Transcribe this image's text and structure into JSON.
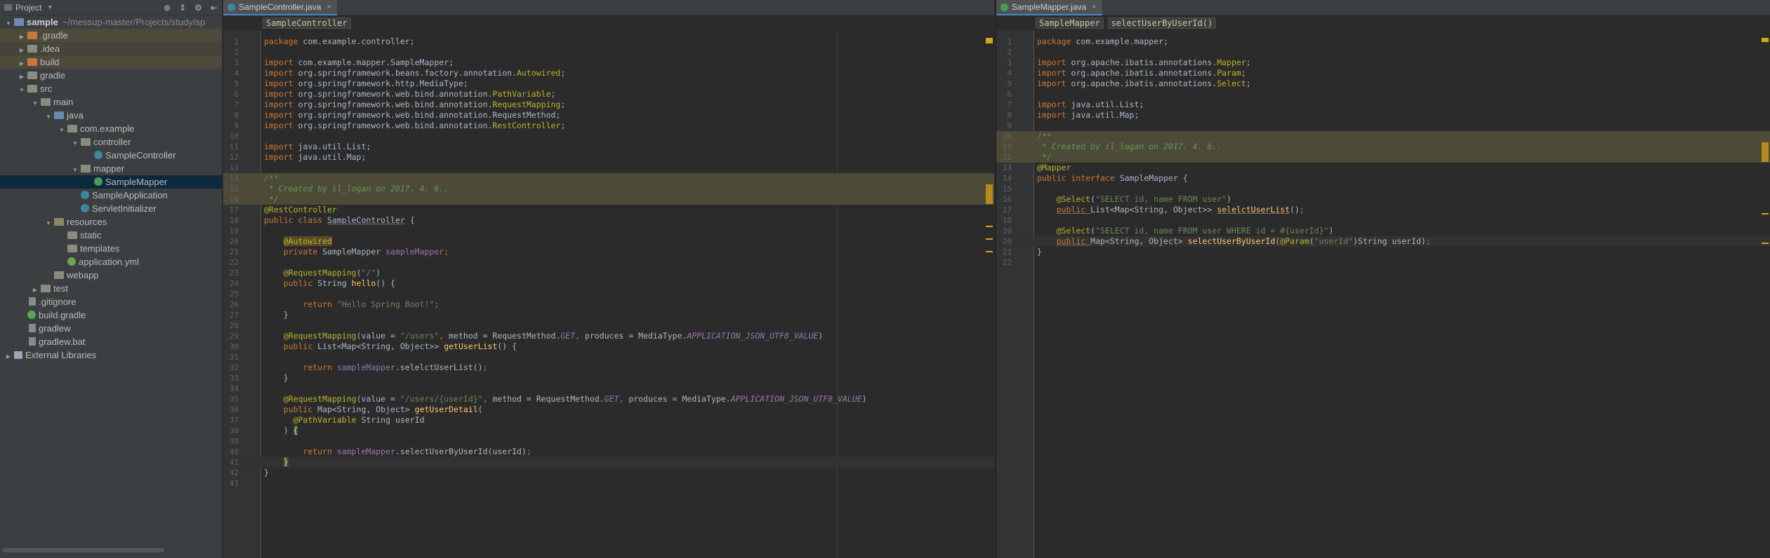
{
  "sidebar": {
    "title": "Project",
    "tree": [
      {
        "label": "sample",
        "suffix": "~/messup-master/Projects/study/sp",
        "depth": 0,
        "arrow": "open",
        "icon": "folder-blue",
        "bold": true
      },
      {
        "label": ".gradle",
        "depth": 1,
        "arrow": "closed",
        "icon": "folder-orange",
        "bg": "hl"
      },
      {
        "label": ".idea",
        "depth": 1,
        "arrow": "closed",
        "icon": "folder",
        "bg": "bg-ex"
      },
      {
        "label": "build",
        "depth": 1,
        "arrow": "closed",
        "icon": "folder-orange",
        "bg": "hl"
      },
      {
        "label": "gradle",
        "depth": 1,
        "arrow": "closed",
        "icon": "folder"
      },
      {
        "label": "src",
        "depth": 1,
        "arrow": "open",
        "icon": "folder"
      },
      {
        "label": "main",
        "depth": 2,
        "arrow": "open",
        "icon": "folder"
      },
      {
        "label": "java",
        "depth": 3,
        "arrow": "open",
        "icon": "folder-src"
      },
      {
        "label": "com.example",
        "depth": 4,
        "arrow": "open",
        "icon": "folder"
      },
      {
        "label": "controller",
        "depth": 5,
        "arrow": "open",
        "icon": "folder"
      },
      {
        "label": "SampleController",
        "depth": 6,
        "arrow": "none",
        "icon": "cls"
      },
      {
        "label": "mapper",
        "depth": 5,
        "arrow": "open",
        "icon": "folder"
      },
      {
        "label": "SampleMapper",
        "depth": 6,
        "arrow": "none",
        "icon": "iface",
        "bg": "sel"
      },
      {
        "label": "SampleApplication",
        "depth": 5,
        "arrow": "none",
        "icon": "cls"
      },
      {
        "label": "ServletInitializer",
        "depth": 5,
        "arrow": "none",
        "icon": "cls"
      },
      {
        "label": "resources",
        "depth": 3,
        "arrow": "open",
        "icon": "folder-res"
      },
      {
        "label": "static",
        "depth": 4,
        "arrow": "none",
        "icon": "folder"
      },
      {
        "label": "templates",
        "depth": 4,
        "arrow": "none",
        "icon": "folder"
      },
      {
        "label": "application.yml",
        "depth": 4,
        "arrow": "none",
        "icon": "yml"
      },
      {
        "label": "webapp",
        "depth": 3,
        "arrow": "none",
        "icon": "folder"
      },
      {
        "label": "test",
        "depth": 2,
        "arrow": "closed",
        "icon": "folder"
      },
      {
        "label": ".gitignore",
        "depth": 1,
        "arrow": "none",
        "icon": "file"
      },
      {
        "label": "build.gradle",
        "depth": 1,
        "arrow": "none",
        "icon": "gradle"
      },
      {
        "label": "gradlew",
        "depth": 1,
        "arrow": "none",
        "icon": "file"
      },
      {
        "label": "gradlew.bat",
        "depth": 1,
        "arrow": "none",
        "icon": "file"
      },
      {
        "label": "External Libraries",
        "depth": 0,
        "arrow": "closed",
        "icon": "lib"
      }
    ]
  },
  "left_editor": {
    "tab_label": "SampleController.java",
    "tab_close": "×",
    "breadcrumbs": [
      "SampleController"
    ],
    "lines": [
      [
        [
          "kw",
          "package "
        ],
        [
          "plain",
          "com.example.controller;"
        ]
      ],
      [],
      [
        [
          "kw",
          "import "
        ],
        [
          "plain",
          "com.example.mapper.SampleMapper;"
        ]
      ],
      [
        [
          "kw",
          "import "
        ],
        [
          "plain",
          "org.springframework.beans.factory.annotation."
        ],
        [
          "an",
          "Autowired"
        ],
        [
          "plain",
          ";"
        ]
      ],
      [
        [
          "kw",
          "import "
        ],
        [
          "plain",
          "org.springframework.http.MediaType;"
        ]
      ],
      [
        [
          "kw",
          "import "
        ],
        [
          "plain",
          "org.springframework.web.bind.annotation."
        ],
        [
          "an",
          "PathVariable"
        ],
        [
          "plain",
          ";"
        ]
      ],
      [
        [
          "kw",
          "import "
        ],
        [
          "plain",
          "org.springframework.web.bind.annotation."
        ],
        [
          "an",
          "RequestMapping"
        ],
        [
          "plain",
          ";"
        ]
      ],
      [
        [
          "kw",
          "import "
        ],
        [
          "plain",
          "org.springframework.web.bind.annotation.RequestMethod;"
        ]
      ],
      [
        [
          "kw",
          "import "
        ],
        [
          "plain",
          "org.springframework.web.bind.annotation."
        ],
        [
          "an",
          "RestController"
        ],
        [
          "plain",
          ";"
        ]
      ],
      [],
      [
        [
          "kw",
          "import "
        ],
        [
          "plain",
          "java.util.List;"
        ]
      ],
      [
        [
          "kw",
          "import "
        ],
        [
          "plain",
          "java.util.Map;"
        ]
      ],
      [],
      [
        [
          "cm",
          "/**"
        ]
      ],
      [
        [
          "cm",
          " * Created by il_logan on 2017. 4. 6.."
        ]
      ],
      [
        [
          "cm",
          " */"
        ]
      ],
      [
        [
          "an",
          "@RestController"
        ]
      ],
      [
        [
          "kw",
          "public class "
        ],
        [
          "ul",
          "SampleController"
        ],
        [
          "plain",
          " {"
        ]
      ],
      [],
      [
        [
          "plain",
          "    "
        ],
        [
          "aw",
          "@Autowired"
        ]
      ],
      [
        [
          "plain",
          "    "
        ],
        [
          "kw",
          "private "
        ],
        [
          "plain",
          "SampleMapper "
        ],
        [
          "fd",
          "sampleMapper"
        ],
        [
          "kw",
          ";"
        ]
      ],
      [],
      [
        [
          "plain",
          "    "
        ],
        [
          "an",
          "@RequestMapping"
        ],
        [
          "plain",
          "("
        ],
        [
          "st",
          "\"/\""
        ],
        [
          "plain",
          ")"
        ]
      ],
      [
        [
          "plain",
          "    "
        ],
        [
          "kw",
          "public "
        ],
        [
          "plain",
          "String "
        ],
        [
          "fn",
          "hello"
        ],
        [
          "plain",
          "() {"
        ]
      ],
      [],
      [
        [
          "plain",
          "        "
        ],
        [
          "kw",
          "return "
        ],
        [
          "st",
          "\"Hello Spring Boot!\""
        ],
        [
          "kw",
          ";"
        ]
      ],
      [
        [
          "plain",
          "    }"
        ]
      ],
      [],
      [
        [
          "plain",
          "    "
        ],
        [
          "an",
          "@RequestMapping"
        ],
        [
          "plain",
          "(value = "
        ],
        [
          "st",
          "\"/users\""
        ],
        [
          "kw",
          ", "
        ],
        [
          "plain",
          "method = RequestMethod."
        ],
        [
          "fdi",
          "GET"
        ],
        [
          "kw",
          ", "
        ],
        [
          "plain",
          "produces = MediaType."
        ],
        [
          "fdi",
          "APPLICATION_JSON_UTF8_VALUE"
        ],
        [
          "plain",
          ")"
        ]
      ],
      [
        [
          "plain",
          "    "
        ],
        [
          "kw",
          "public "
        ],
        [
          "plain",
          "List<Map<String, Object>> "
        ],
        [
          "fn",
          "getUserList"
        ],
        [
          "plain",
          "() {"
        ]
      ],
      [],
      [
        [
          "plain",
          "        "
        ],
        [
          "kw",
          "return "
        ],
        [
          "fd",
          "sampleMapper"
        ],
        [
          "plain",
          ".selelctUserList()"
        ],
        [
          "kw",
          ";"
        ]
      ],
      [
        [
          "plain",
          "    }"
        ]
      ],
      [],
      [
        [
          "plain",
          "    "
        ],
        [
          "an",
          "@RequestMapping"
        ],
        [
          "plain",
          "(value = "
        ],
        [
          "st",
          "\"/users/{userId}\""
        ],
        [
          "kw",
          ", "
        ],
        [
          "plain",
          "method = RequestMethod."
        ],
        [
          "fdi",
          "GET"
        ],
        [
          "kw",
          ", "
        ],
        [
          "plain",
          "produces = MediaType."
        ],
        [
          "fdi",
          "APPLICATION_JSON_UTF8_VALUE"
        ],
        [
          "plain",
          ")"
        ]
      ],
      [
        [
          "plain",
          "    "
        ],
        [
          "kw",
          "public "
        ],
        [
          "plain",
          "Map<String, Object> "
        ],
        [
          "fn",
          "getUserDetail"
        ],
        [
          "plain",
          "("
        ]
      ],
      [
        [
          "plain",
          "      "
        ],
        [
          "an",
          "@PathVariable "
        ],
        [
          "plain",
          "String userId"
        ]
      ],
      [
        [
          "plain",
          "    ) "
        ],
        [
          "bh",
          "{"
        ]
      ],
      [],
      [
        [
          "plain",
          "        "
        ],
        [
          "kw",
          "return "
        ],
        [
          "fd",
          "sampleMapper"
        ],
        [
          "plain",
          ".selectUserByUserId(userId)"
        ],
        [
          "kw",
          ";"
        ]
      ],
      [
        [
          "plain",
          "    "
        ],
        [
          "bh",
          "}"
        ]
      ],
      [
        [
          "plain",
          "}"
        ]
      ],
      []
    ],
    "doc_lines": [
      14,
      15,
      16
    ],
    "current_line": 41
  },
  "right_editor": {
    "tab_label": "SampleMapper.java",
    "tab_close": "×",
    "breadcrumbs": [
      "SampleMapper",
      "selectUserByUserId()"
    ],
    "lines": [
      [
        [
          "kw",
          "package "
        ],
        [
          "plain",
          "com.example.mapper;"
        ]
      ],
      [],
      [
        [
          "kw",
          "import "
        ],
        [
          "plain",
          "org.apache.ibatis.annotations."
        ],
        [
          "an",
          "Mapper"
        ],
        [
          "plain",
          ";"
        ]
      ],
      [
        [
          "kw",
          "import "
        ],
        [
          "plain",
          "org.apache.ibatis.annotations."
        ],
        [
          "an",
          "Param"
        ],
        [
          "plain",
          ";"
        ]
      ],
      [
        [
          "kw",
          "import "
        ],
        [
          "plain",
          "org.apache.ibatis.annotations."
        ],
        [
          "an",
          "Select"
        ],
        [
          "plain",
          ";"
        ]
      ],
      [],
      [
        [
          "kw",
          "import "
        ],
        [
          "plain",
          "java.util.List;"
        ]
      ],
      [
        [
          "kw",
          "import "
        ],
        [
          "plain",
          "java.util.Map;"
        ]
      ],
      [],
      [
        [
          "cm",
          "/**"
        ]
      ],
      [
        [
          "cm",
          " * Created by il_logan on 2017. 4. 6.."
        ]
      ],
      [
        [
          "cm",
          " */"
        ]
      ],
      [
        [
          "an",
          "@Mapper"
        ]
      ],
      [
        [
          "kw",
          "public interface "
        ],
        [
          "plain",
          "SampleMapper {"
        ]
      ],
      [],
      [
        [
          "plain",
          "    "
        ],
        [
          "an",
          "@Select"
        ],
        [
          "plain",
          "("
        ],
        [
          "st",
          "\"SELECT id, name FROM user\""
        ],
        [
          "plain",
          ")"
        ]
      ],
      [
        [
          "plain",
          "    "
        ],
        [
          "ulk",
          "public "
        ],
        [
          "plain",
          "List<Map<String, Object>> "
        ],
        [
          "fnu",
          "selelctUserList"
        ],
        [
          "plain",
          "()"
        ],
        [
          "kw",
          ";"
        ]
      ],
      [],
      [
        [
          "plain",
          "    "
        ],
        [
          "an",
          "@Select"
        ],
        [
          "plain",
          "("
        ],
        [
          "st",
          "\"SELECT id, name FROM user WHERE id = #{userId}\""
        ],
        [
          "plain",
          ")"
        ]
      ],
      [
        [
          "plain",
          "    "
        ],
        [
          "ulk",
          "public "
        ],
        [
          "plain",
          "Map<String, Object> "
        ],
        [
          "fn",
          "selectUserByUserId"
        ],
        [
          "plain",
          "("
        ],
        [
          "an",
          "@Param"
        ],
        [
          "plain",
          "("
        ],
        [
          "st",
          "\"userId\""
        ],
        [
          "plain",
          ")String userId)"
        ],
        [
          "kw",
          ";"
        ]
      ],
      [
        [
          "plain",
          "}"
        ]
      ],
      []
    ],
    "doc_lines": [
      10,
      11,
      12
    ],
    "current_line": 20
  },
  "colors": {
    "keyword": "#cc7832",
    "annotation": "#bbb529",
    "string": "#6a8759",
    "method": "#ffc66d",
    "field": "#9876aa",
    "comment": "#629755",
    "text": "#a9b7c6",
    "selection": "#0d293e"
  }
}
